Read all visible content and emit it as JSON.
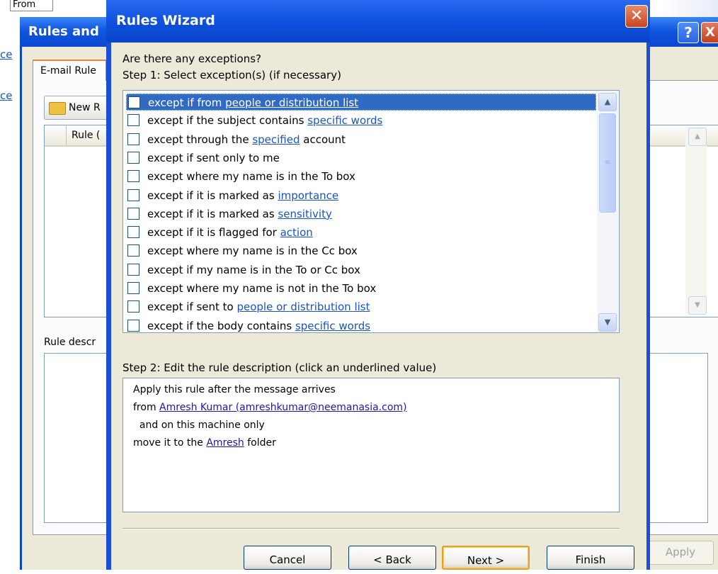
{
  "background_window": {
    "from_header": "From",
    "title": "Rules and",
    "help_glyph": "?",
    "close_glyph": "X",
    "left_snippets": [
      "ce",
      "ce"
    ],
    "tab_label": "E-mail Rule",
    "new_rule_label": "New R",
    "column_header": "Rule (",
    "description_label": "Rule descr",
    "apply_label": "Apply"
  },
  "wizard": {
    "title": "Rules Wizard",
    "close_glyph": "✕",
    "question": "Are there any exceptions?",
    "step1_label": "Step 1: Select exception(s) (if necessary)",
    "conditions": [
      {
        "prefix": "except if from ",
        "link": "people or distribution list",
        "suffix": "",
        "selected": true
      },
      {
        "prefix": "except if the subject contains ",
        "link": "specific words",
        "suffix": "",
        "selected": false
      },
      {
        "prefix": "except through the ",
        "link": "specified",
        "suffix": " account",
        "selected": false
      },
      {
        "prefix": "except if sent only to me",
        "link": "",
        "suffix": "",
        "selected": false
      },
      {
        "prefix": "except where my name is in the To box",
        "link": "",
        "suffix": "",
        "selected": false
      },
      {
        "prefix": "except if it is marked as ",
        "link": "importance",
        "suffix": "",
        "selected": false
      },
      {
        "prefix": "except if it is marked as ",
        "link": "sensitivity",
        "suffix": "",
        "selected": false
      },
      {
        "prefix": "except if it is flagged for ",
        "link": "action",
        "suffix": "",
        "selected": false
      },
      {
        "prefix": "except where my name is in the Cc box",
        "link": "",
        "suffix": "",
        "selected": false
      },
      {
        "prefix": "except if my name is in the To or Cc box",
        "link": "",
        "suffix": "",
        "selected": false
      },
      {
        "prefix": "except where my name is not in the To box",
        "link": "",
        "suffix": "",
        "selected": false
      },
      {
        "prefix": "except if sent to ",
        "link": "people or distribution list",
        "suffix": "",
        "selected": false
      },
      {
        "prefix": "except if the body contains ",
        "link": "specific words",
        "suffix": "",
        "selected": false
      }
    ],
    "step2_label": "Step 2: Edit the rule description (click an underlined value)",
    "description": {
      "line1": "Apply this rule after the message arrives",
      "line2_prefix": "from ",
      "line2_link": "Amresh Kumar (amreshkumar@neemanasia.com)",
      "line3": "  and on this machine only",
      "line4_prefix": "move it to the ",
      "line4_link": "Amresh",
      "line4_suffix": " folder"
    },
    "buttons": {
      "cancel": "Cancel",
      "back": "< Back",
      "next": "Next >",
      "finish": "Finish"
    }
  },
  "colors": {
    "title_blue": "#0d4fdc",
    "selection": "#316ac5",
    "link": "#1a54c4",
    "dialog_face": "#ece9d8"
  }
}
